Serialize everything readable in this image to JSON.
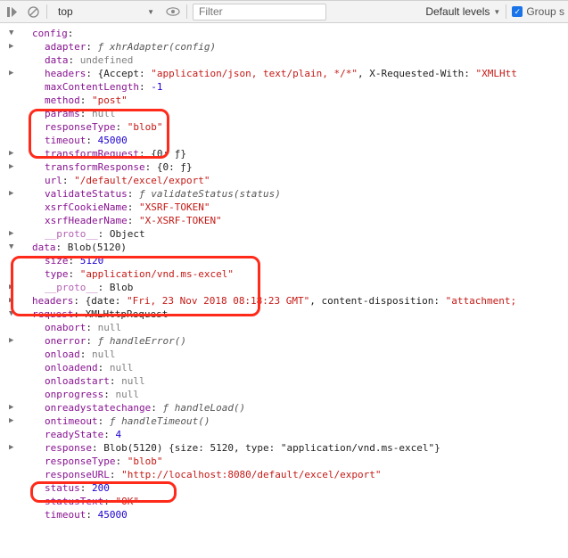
{
  "toolbar": {
    "context": "top",
    "filter_placeholder": "Filter",
    "levels": "Default levels",
    "group": "Group s"
  },
  "tree": {
    "config": {
      "label": "config",
      "adapter_key": "adapter",
      "adapter_val": "ƒ xhrAdapter(config)",
      "data_key": "data",
      "data_val": "undefined",
      "headers_key": "headers",
      "headers_open": "{",
      "headers_accept_k": "Accept: ",
      "headers_accept_v": "\"application/json, text/plain, */*\"",
      "headers_xreq_k": ", X-Requested-With: ",
      "headers_xreq_v": "\"XMLHtt",
      "maxcl_key": "maxContentLength",
      "maxcl_val": "-1",
      "method_key": "method",
      "method_val": "\"post\"",
      "params_key": "params",
      "params_val": "null",
      "resptype_key": "responseType",
      "resptype_val": "\"blob\"",
      "timeout_key": "timeout",
      "timeout_val": "45000",
      "treq_key": "transformRequest",
      "treq_val": "{0: ƒ}",
      "tres_key": "transformResponse",
      "tres_val": "{0: ƒ}",
      "url_key": "url",
      "url_val": "\"/default/excel/export\"",
      "vstat_key": "validateStatus",
      "vstat_val": "ƒ validateStatus(status)",
      "xcookie_key": "xsrfCookieName",
      "xcookie_val": "\"XSRF-TOKEN\"",
      "xheader_key": "xsrfHeaderName",
      "xheader_val": "\"X-XSRF-TOKEN\"",
      "proto_key": "__proto__",
      "proto_val": "Object"
    },
    "datablob": {
      "label": "data",
      "summary": "Blob(5120)",
      "size_key": "size",
      "size_val": "5120",
      "type_key": "type",
      "type_val": "\"application/vnd.ms-excel\"",
      "proto_key": "__proto__",
      "proto_val": "Blob"
    },
    "headers2": {
      "label": "headers",
      "open": "{",
      "date_k": "date: ",
      "date_v": "\"Fri, 23 Nov 2018 08:18:23 GMT\"",
      "cd_k": ", content-disposition: ",
      "cd_v": "\"attachment;"
    },
    "request": {
      "label": "request",
      "summary": "XMLHttpRequest",
      "onabort_key": "onabort",
      "onabort_val": "null",
      "onerror_key": "onerror",
      "onerror_val": "ƒ handleError()",
      "onload_key": "onload",
      "onload_val": "null",
      "onloadend_key": "onloadend",
      "onloadend_val": "null",
      "onloadstart_key": "onloadstart",
      "onloadstart_val": "null",
      "onprogress_key": "onprogress",
      "onprogress_val": "null",
      "onrsc_key": "onreadystatechange",
      "onrsc_val": "ƒ handleLoad()",
      "ontimeout_key": "ontimeout",
      "ontimeout_val": "ƒ handleTimeout()",
      "ready_key": "readyState",
      "ready_val": "4",
      "response_key": "response",
      "response_sum": "Blob(5120)",
      "response_obj": " {size: 5120, type: \"application/vnd.ms-excel\"}",
      "resptype_key": "responseType",
      "resptype_val": "\"blob\"",
      "respurl_key": "responseURL",
      "respurl_val": "\"http://localhost:8080/default/excel/export\"",
      "status_key": "status",
      "status_val": "200",
      "statustext_key": "statusText",
      "statustext_val": "\"OK\"",
      "timeout_key": "timeout",
      "timeout_val": "45000"
    }
  }
}
